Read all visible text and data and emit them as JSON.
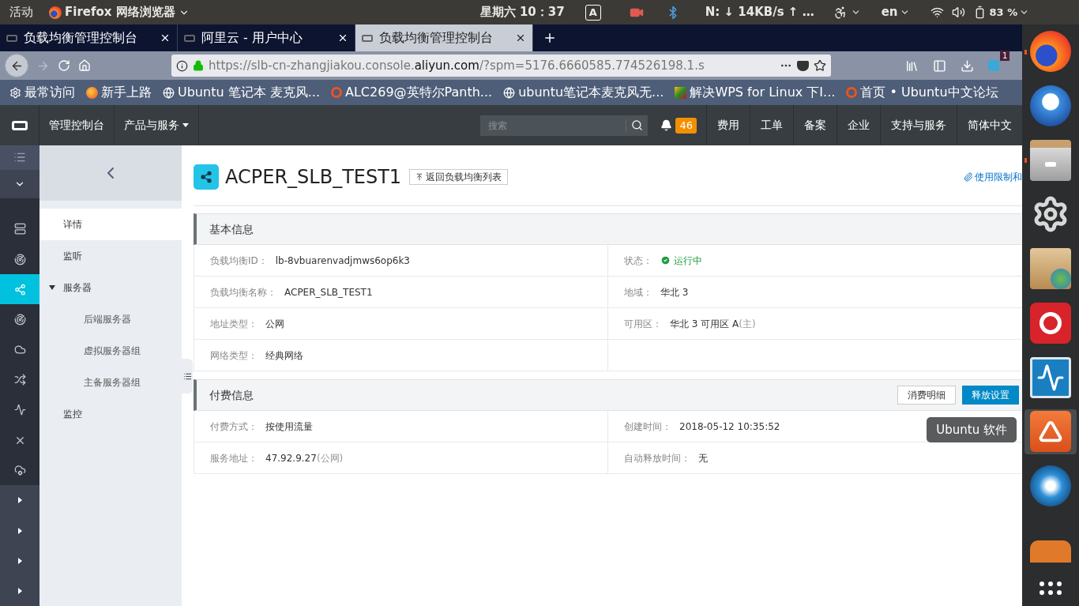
{
  "top_bar": {
    "activities": "活动",
    "app_menu": "Firefox 网络浏览器",
    "clock": "星期六 10：37",
    "keyboard": "A",
    "network": "N: ↓  14KB/s ↑  …",
    "language": "en",
    "battery": "83 %"
  },
  "browser_tabs": [
    {
      "title": "负载均衡管理控制台",
      "selected": false
    },
    {
      "title": "阿里云 - 用户中心",
      "selected": false
    },
    {
      "title": "负载均衡管理控制台",
      "selected": true
    }
  ],
  "address_bar": {
    "url_start": "https://slb-cn-zhangjiakou.console.",
    "url_domain": "aliyun.com",
    "url_end": "/?spm=5176.6660585.774526198.1.s",
    "extension_badge": "1"
  },
  "bookmarks": [
    {
      "kind": "settings",
      "label": "最常访问"
    },
    {
      "kind": "browser",
      "label": "新手上路"
    },
    {
      "kind": "globe",
      "label": "Ubuntu 笔记本 麦克风..."
    },
    {
      "kind": "ubuntu",
      "label": "ALC269@英特尔Panth..."
    },
    {
      "kind": "globe",
      "label": "ubuntu笔记本麦克风无..."
    },
    {
      "kind": "site",
      "label": "解决WPS for Linux  下I..."
    },
    {
      "kind": "ubuntu",
      "label": "首页 • Ubuntu中文论坛"
    }
  ],
  "console_header": {
    "nav": [
      {
        "label": "管理控制台",
        "dropdown": false
      },
      {
        "label": "产品与服务",
        "dropdown": true
      }
    ],
    "search": {
      "placeholder": "搜索"
    },
    "notifications": "46",
    "links": [
      "费用",
      "工单",
      "备案",
      "企业",
      "支持与服务",
      "简体中文"
    ]
  },
  "icon_rail": [
    {
      "kind": "menu",
      "selected": false
    },
    {
      "kind": "dropdown",
      "selected": false
    },
    {
      "kind": "product",
      "selected": false
    },
    {
      "kind": "product",
      "selected": false
    },
    {
      "kind": "product",
      "selected": true
    },
    {
      "kind": "product",
      "selected": false
    },
    {
      "kind": "product",
      "selected": false
    },
    {
      "kind": "product",
      "selected": false
    },
    {
      "kind": "product",
      "selected": false
    },
    {
      "kind": "product",
      "selected": false
    },
    {
      "kind": "product",
      "selected": false
    },
    {
      "kind": "expand",
      "selected": false
    },
    {
      "kind": "expand",
      "selected": false
    },
    {
      "kind": "expand",
      "selected": false
    },
    {
      "kind": "expand",
      "selected": false
    }
  ],
  "side_menu": [
    {
      "label": "详情",
      "selected": true
    },
    {
      "label": "监听",
      "selected": false
    },
    {
      "label": "服务器",
      "selected": false,
      "expanded": true,
      "children": [
        {
          "label": "后端服务器",
          "selected": false
        },
        {
          "label": "虚拟服务器组",
          "selected": false
        },
        {
          "label": "主备服务器组",
          "selected": false
        }
      ]
    },
    {
      "label": "监控",
      "selected": false
    }
  ],
  "page": {
    "title": "ACPER_SLB_TEST1",
    "back_button": "返回负载均衡列表",
    "help_link": "使用限制和"
  },
  "sections": [
    {
      "title": "基本信息",
      "fields": [
        {
          "kind": "text",
          "label": "负载均衡ID：",
          "value": "lb-8vbuarenvadjmws6op6k3"
        },
        {
          "kind": "status",
          "label": "状态：",
          "value": "运行中"
        },
        {
          "kind": "text",
          "label": "负载均衡名称：",
          "value": "ACPER_SLB_TEST1"
        },
        {
          "kind": "text",
          "label": "地域：",
          "value": "华北 3"
        },
        {
          "kind": "text",
          "label": "地址类型：",
          "value": "公网"
        },
        {
          "kind": "text",
          "label": "可用区：",
          "value": "华北 3 可用区 A",
          "note": "(主)"
        },
        {
          "kind": "text",
          "label": "网络类型：",
          "value": "经典网络"
        }
      ]
    },
    {
      "title": "付费信息",
      "buttons": [
        {
          "label": "消费明细",
          "primary": false
        },
        {
          "label": "释放设置",
          "primary": true
        }
      ],
      "fields": [
        {
          "kind": "text",
          "label": "付费方式：",
          "value": "按使用流量"
        },
        {
          "kind": "text",
          "label": "创建时间：",
          "value": "2018-05-12 10:35:52"
        },
        {
          "kind": "text",
          "label": "服务地址：",
          "value": "47.92.9.27",
          "note": "(公网)"
        },
        {
          "kind": "text",
          "label": "自动释放时间：",
          "value": "无"
        }
      ]
    }
  ],
  "dock": {
    "items": [
      {
        "kind": "browser",
        "running": true
      },
      {
        "kind": "mail",
        "running": false
      },
      {
        "kind": "files",
        "running": true
      },
      {
        "kind": "tools",
        "running": false
      },
      {
        "kind": "archive",
        "running": false
      },
      {
        "kind": "music",
        "running": false
      },
      {
        "kind": "monitor",
        "running": false
      },
      {
        "kind": "store",
        "running": false,
        "hovered": true
      },
      {
        "kind": "disc",
        "running": false
      },
      {
        "kind": "app",
        "running": false
      }
    ],
    "tooltip": "Ubuntu 软件"
  }
}
